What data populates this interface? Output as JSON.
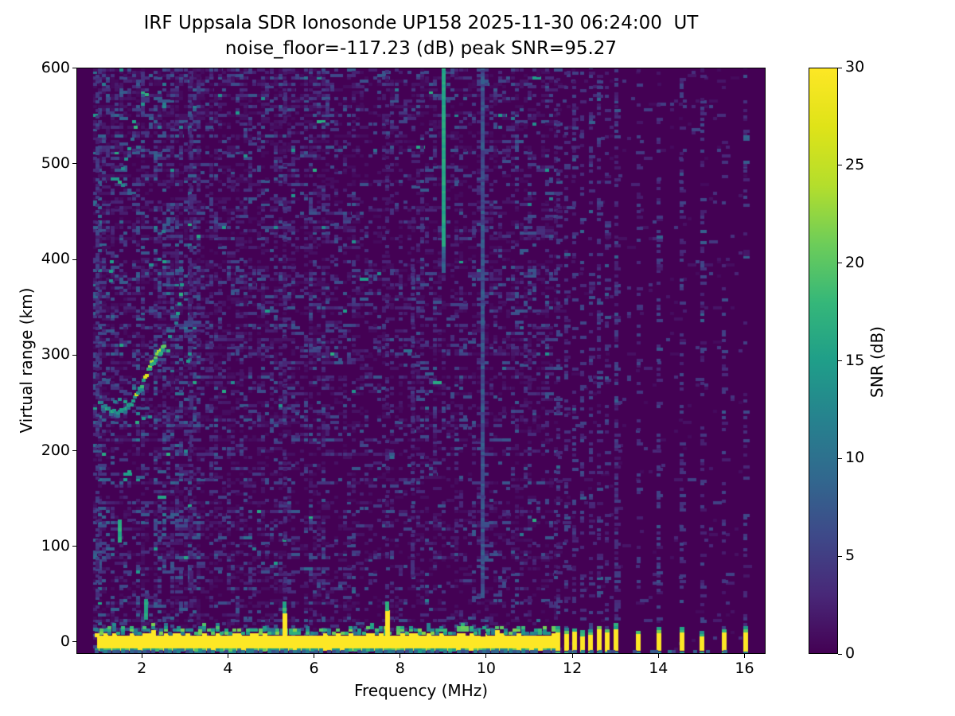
{
  "figure": {
    "title_line1": "IRF Uppsala SDR Ionosonde UP158 2025-11-30 06:24:00  UT",
    "title_line2": "noise_floor=-117.23 (dB) peak SNR=95.27",
    "xlabel": "Frequency (MHz)",
    "ylabel": "Virtual range (km)",
    "colorbar_label": "SNR (dB)"
  },
  "chart_data": {
    "type": "heatmap",
    "title": "IRF Uppsala SDR Ionosonde UP158 2025-11-30 06:24:00  UT",
    "subtitle": "noise_floor=-117.23 (dB) peak SNR=95.27",
    "station": "UP158",
    "timestamp": "2025-11-30 06:24:00 UT",
    "noise_floor_db": -117.23,
    "peak_snr_db": 95.27,
    "xlabel": "Frequency (MHz)",
    "ylabel": "Virtual range (km)",
    "xlim": [
      0.48,
      16.49
    ],
    "ylim": [
      -12.5,
      600.5
    ],
    "xticks": [
      2,
      4,
      6,
      8,
      10,
      12,
      14,
      16
    ],
    "yticks": [
      0,
      100,
      200,
      300,
      400,
      500,
      600
    ],
    "grid": false,
    "colorbar": {
      "label": "SNR (dB)",
      "min": 0,
      "max": 30,
      "ticks": [
        0,
        5,
        10,
        15,
        20,
        25,
        30
      ],
      "colormap": "viridis",
      "stops": [
        "#440154",
        "#482878",
        "#3e4989",
        "#31688e",
        "#26828e",
        "#1f9e89",
        "#35b779",
        "#6dcd59",
        "#b4de2c",
        "#dfe318",
        "#fde725"
      ]
    },
    "background_snr": 0,
    "noise_regions": [
      {
        "f0": 0.92,
        "f1": 1.1,
        "density": 0.62,
        "snr_max": 9,
        "teal_p": 0.05
      },
      {
        "f0": 1.1,
        "f1": 3.4,
        "density": 0.48,
        "snr_max": 8,
        "teal_p": 0.02
      },
      {
        "f0": 3.4,
        "f1": 7.6,
        "density": 0.34,
        "snr_max": 7,
        "teal_p": 0.012
      },
      {
        "f0": 7.6,
        "f1": 11.65,
        "density": 0.3,
        "snr_max": 7,
        "teal_p": 0.008
      },
      {
        "f0": 11.65,
        "f1": 16.06,
        "density": 0.03,
        "snr_max": 5,
        "teal_p": 0.001
      }
    ],
    "rfi_columns": [
      {
        "f": 0.97,
        "km0": 20,
        "km1": 600,
        "snr": 4,
        "density": 0.5,
        "jitter": 4
      },
      {
        "f": 3.16,
        "km0": -6,
        "km1": 600,
        "snr": 3.2,
        "density": 0.45,
        "jitter": 3
      },
      {
        "f": 5.33,
        "km0": 44,
        "km1": 600,
        "snr": 3.0,
        "density": 0.3,
        "jitter": 3
      },
      {
        "f": 7.7,
        "km0": 46,
        "km1": 600,
        "snr": 2.8,
        "density": 0.25,
        "jitter": 3
      },
      {
        "f": 8.3,
        "km0": 50,
        "km1": 410,
        "snr": 3.4,
        "density": 0.45,
        "jitter": 3
      },
      {
        "f": 9.01,
        "km0": 412,
        "km1": 600,
        "snr": 16,
        "density": 1,
        "solid": true,
        "jitter": 2
      },
      {
        "f": 9.01,
        "km0": 386,
        "km1": 412,
        "snr": 8,
        "density": 0.9,
        "jitter": 3
      },
      {
        "f": 9.93,
        "km0": 46,
        "km1": 600,
        "snr": 6.5,
        "density": 1,
        "solid": true,
        "jitter": 4
      }
    ],
    "ground_band": {
      "f0": 0.96,
      "f1": 11.62,
      "top": 6.5,
      "bottom": -8.5
    },
    "band_notch": {
      "f": 9.93,
      "km0": 5.5,
      "km1": 13
    },
    "bottom_bars": {
      "freqs": [
        11.67,
        11.86,
        12.05,
        12.24,
        12.43,
        12.62,
        12.81,
        13.02,
        13.54,
        14.01,
        14.54,
        15.02,
        15.52,
        16.02
      ],
      "trail_density": [
        0.45,
        0.4,
        0.5,
        0.45,
        0.4,
        0.45,
        0.4,
        0.5,
        0.3,
        0.45,
        0.35,
        0.45,
        0.3,
        0.35
      ],
      "km_bottom": -8.5,
      "km_top_range": [
        5,
        11
      ]
    },
    "spikes": [
      {
        "f": 5.31,
        "yellow_top": 30,
        "teal_top": 39
      },
      {
        "f": 7.7,
        "yellow_top": 33,
        "teal_top": 41
      }
    ],
    "teal_streaks": [
      {
        "f": 2.1,
        "km0": 24,
        "km1": 44,
        "snr": 15
      },
      {
        "f": 1.5,
        "km0": 104,
        "km1": 126,
        "snr": 16
      }
    ],
    "echo_trace": {
      "bright_f": [
        1.86,
        2.58
      ],
      "points": [
        [
          1.02,
          250
        ],
        [
          1.1,
          246
        ],
        [
          1.2,
          242
        ],
        [
          1.32,
          239
        ],
        [
          1.45,
          239
        ],
        [
          1.58,
          241
        ],
        [
          1.7,
          245
        ],
        [
          1.8,
          250
        ],
        [
          1.88,
          256
        ],
        [
          1.96,
          263
        ],
        [
          2.04,
          271
        ],
        [
          2.12,
          279
        ],
        [
          2.2,
          287
        ],
        [
          2.28,
          294
        ],
        [
          2.36,
          299
        ],
        [
          2.46,
          304
        ],
        [
          2.56,
          308
        ]
      ]
    },
    "upper_trace": {
      "density": 0.78,
      "points": [
        [
          1.5,
          480
        ],
        [
          1.57,
          492
        ],
        [
          1.64,
          503
        ],
        [
          1.71,
          514
        ],
        [
          1.79,
          526
        ],
        [
          1.87,
          538
        ],
        [
          1.95,
          549
        ],
        [
          2.03,
          559
        ],
        [
          2.12,
          570
        ],
        [
          2.21,
          580
        ],
        [
          2.31,
          588
        ]
      ]
    },
    "scatter_dots": [
      [
        1.38,
        250
      ],
      [
        1.5,
        252
      ],
      [
        1.62,
        250
      ],
      [
        2.8,
        332
      ],
      [
        2.84,
        342
      ],
      [
        2.88,
        352
      ],
      [
        2.91,
        362
      ],
      [
        2.94,
        372
      ],
      [
        2.66,
        318
      ],
      [
        3.08,
        292
      ],
      [
        3.12,
        300
      ],
      [
        1.28,
        376
      ],
      [
        1.28,
        386
      ],
      [
        1.3,
        396
      ],
      [
        2.5,
        428
      ],
      [
        2.05,
        232
      ],
      [
        2.2,
        234
      ],
      [
        1.9,
        228
      ]
    ]
  }
}
